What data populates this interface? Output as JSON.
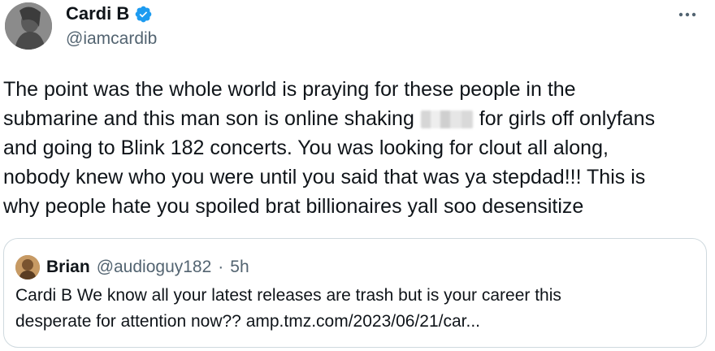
{
  "author": {
    "display_name": "Cardi B",
    "handle": "@iamcardib",
    "avatar_icon": "user-avatar",
    "verified_icon": "verified-badge-icon",
    "verified_color": "#1d9bf0"
  },
  "more_icon": "more-horizontal-icon",
  "tweet": {
    "lines": [
      "The point was the whole world is praying for these people in the",
      "submarine and this man son is online shaking",
      "for girls off onlyfans",
      "and going to Blink 182 concerts. You was looking for clout all along,",
      "nobody knew who you were until you said that was ya stepdad!!! This is",
      "why people hate you spoiled brat billionaires yall soo desensitize"
    ],
    "redacted_word_icon": "blurred-word"
  },
  "quote": {
    "display_name": "Brian",
    "handle": "@audioguy182",
    "separator": "·",
    "time": "5h",
    "avatar_icon": "user-avatar",
    "lines": [
      "Cardi B We know all your latest releases are trash but is your career this",
      "desperate for attention now?? amp.tmz.com/2023/06/21/car..."
    ]
  },
  "colors": {
    "text": "#0f1419",
    "secondary": "#536471",
    "border": "#cfd9de"
  }
}
